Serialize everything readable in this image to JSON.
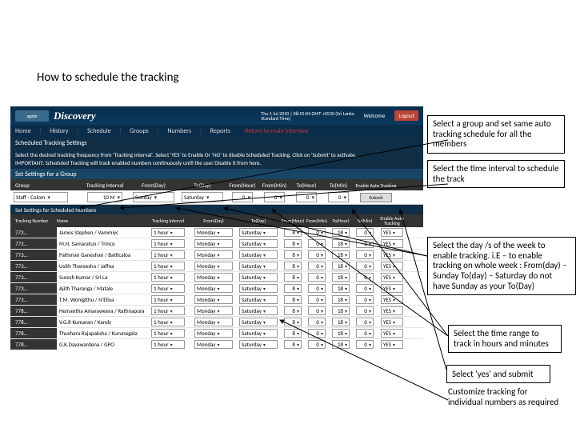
{
  "slide": {
    "title": "How to schedule the tracking "
  },
  "header": {
    "logo": "agate",
    "brand": "Discovery",
    "datetime_line1": "Thu 1 Jul 2010 | 08:55:04 GMT +0530 (Sri Lanka",
    "datetime_line2": "Standard Time)",
    "welcome": "Welcome",
    "logout": "Logout"
  },
  "nav": {
    "items": [
      "Home",
      "History",
      "Schedule",
      "Groups",
      "Numbers",
      "Reports"
    ],
    "return": "Return to main interface"
  },
  "bar1": "Scheduled Tracking Settings",
  "bar2_l1": "Select the desired tracking frequency from 'Tracking Interval'. Select 'YES' to Enable Or 'NO' to disable Scheduled Tracking. Click on 'Submit' to activate.",
  "bar2_l2": "IMPORTANT: Scheduled Tracking will track enabled numbers continuously until the user Disable it from here.",
  "bar3": "Set Settings for a Group",
  "groupCols": {
    "group": "Group",
    "interval": "Tracking Interval",
    "fromDay": "From(Day)",
    "toDay": "To(Day)",
    "fromHour": "From(Hour)",
    "fromMin": "From(Min)",
    "toHour": "To(Hour)",
    "toMin": "To(Min)",
    "enable": "Enable Auto\nTracking"
  },
  "groupRow": {
    "group": "Staff - Colom",
    "interval": "10 M",
    "fromDay": "Sunday",
    "toDay": "Saturday",
    "fh": "0",
    "fm": "0",
    "th": "0",
    "tm": "0",
    "submit": "Submit"
  },
  "bar4": "Set Settings for Scheduled Numbers",
  "numCols": {
    "num": "Tracking Number",
    "name": "Name",
    "interval": "Tracking Interval",
    "fromDay": "From(Day)",
    "toDay": "To(Day)",
    "fh": "From(Hour)",
    "fm": "From(Min)",
    "th": "To(Hour)",
    "tm": "To(Min)",
    "en": "Enable Auto\nTracking"
  },
  "rows": [
    {
      "num": "772…",
      "name": "James Stephen / Vammiyc",
      "int": "1 hour",
      "fd": "Monday",
      "td": "Saturday",
      "fh": "8",
      "fm": "0",
      "th": "18",
      "tm": "0",
      "en": "YES"
    },
    {
      "num": "772…",
      "name": "M.N. Samaratun / Trinco",
      "int": "1 hour",
      "fd": "Monday",
      "td": "Saturday",
      "fh": "8",
      "fm": "0",
      "th": "18",
      "tm": "0",
      "en": "YES"
    },
    {
      "num": "773…",
      "name": "Pathman Ganeshan / Batticaloa",
      "int": "1 hour",
      "fd": "Monday",
      "td": "Saturday",
      "fh": "8",
      "fm": "0",
      "th": "18",
      "tm": "0",
      "en": "YES"
    },
    {
      "num": "773…",
      "name": "Usith Thareesha / Jaffna",
      "int": "1 hour",
      "fd": "Monday",
      "td": "Saturday",
      "fh": "8",
      "fm": "0",
      "th": "18",
      "tm": "0",
      "en": "YES"
    },
    {
      "num": "773…",
      "name": "Suresh Kumar / Sri La",
      "int": "1 hour",
      "fd": "Monday",
      "td": "Saturday",
      "fh": "8",
      "fm": "0",
      "th": "18",
      "tm": "0",
      "en": "YES"
    },
    {
      "num": "773…",
      "name": "Ajith Tharanga / Matale",
      "int": "1 hour",
      "fd": "Monday",
      "td": "Saturday",
      "fh": "8",
      "fm": "0",
      "th": "18",
      "tm": "0",
      "en": "YES"
    },
    {
      "num": "773…",
      "name": "T.M. Wonigithu / N'Eliya",
      "int": "1 hour",
      "fd": "Monday",
      "td": "Saturday",
      "fh": "8",
      "fm": "0",
      "th": "18",
      "tm": "0",
      "en": "YES"
    },
    {
      "num": "778…",
      "name": "Hemantha Amaraweera / Rathnapura",
      "int": "1 hour",
      "fd": "Monday",
      "td": "Saturday",
      "fh": "8",
      "fm": "0",
      "th": "18",
      "tm": "0",
      "en": "YES"
    },
    {
      "num": "778…",
      "name": "V.G.R Kumaran / Kandy",
      "int": "1 hour",
      "fd": "Monday",
      "td": "Saturday",
      "fh": "8",
      "fm": "0",
      "th": "18",
      "tm": "0",
      "en": "YES"
    },
    {
      "num": "778…",
      "name": "Thushara Rajapaksha / Kurunegala",
      "int": "1 hour",
      "fd": "Monday",
      "td": "Saturday",
      "fh": "8",
      "fm": "0",
      "th": "18",
      "tm": "0",
      "en": "YES"
    },
    {
      "num": "778…",
      "name": "G.K.Dayawardena / GPO",
      "int": "1 hour",
      "fd": "Monday",
      "td": "Saturday",
      "fh": "8",
      "fm": "0",
      "th": "18",
      "tm": "0",
      "en": "YES"
    }
  ],
  "callout1": "Select a group and set same auto tracking schedule for all the members",
  "callout2": "Select the time interval to  schedule the track",
  "callout3": "Select the day /s of the week to enable tracking.\ni.E – to enable tracking on whole week : From(day) – Sunday To(day) – Saturday do not have Sunday as your To(Day)",
  "callout4": "Select the time range to track in hours and minutes",
  "callout5": "Select 'yes' and submit",
  "callout6": "Customize tracking for individual numbers as required"
}
